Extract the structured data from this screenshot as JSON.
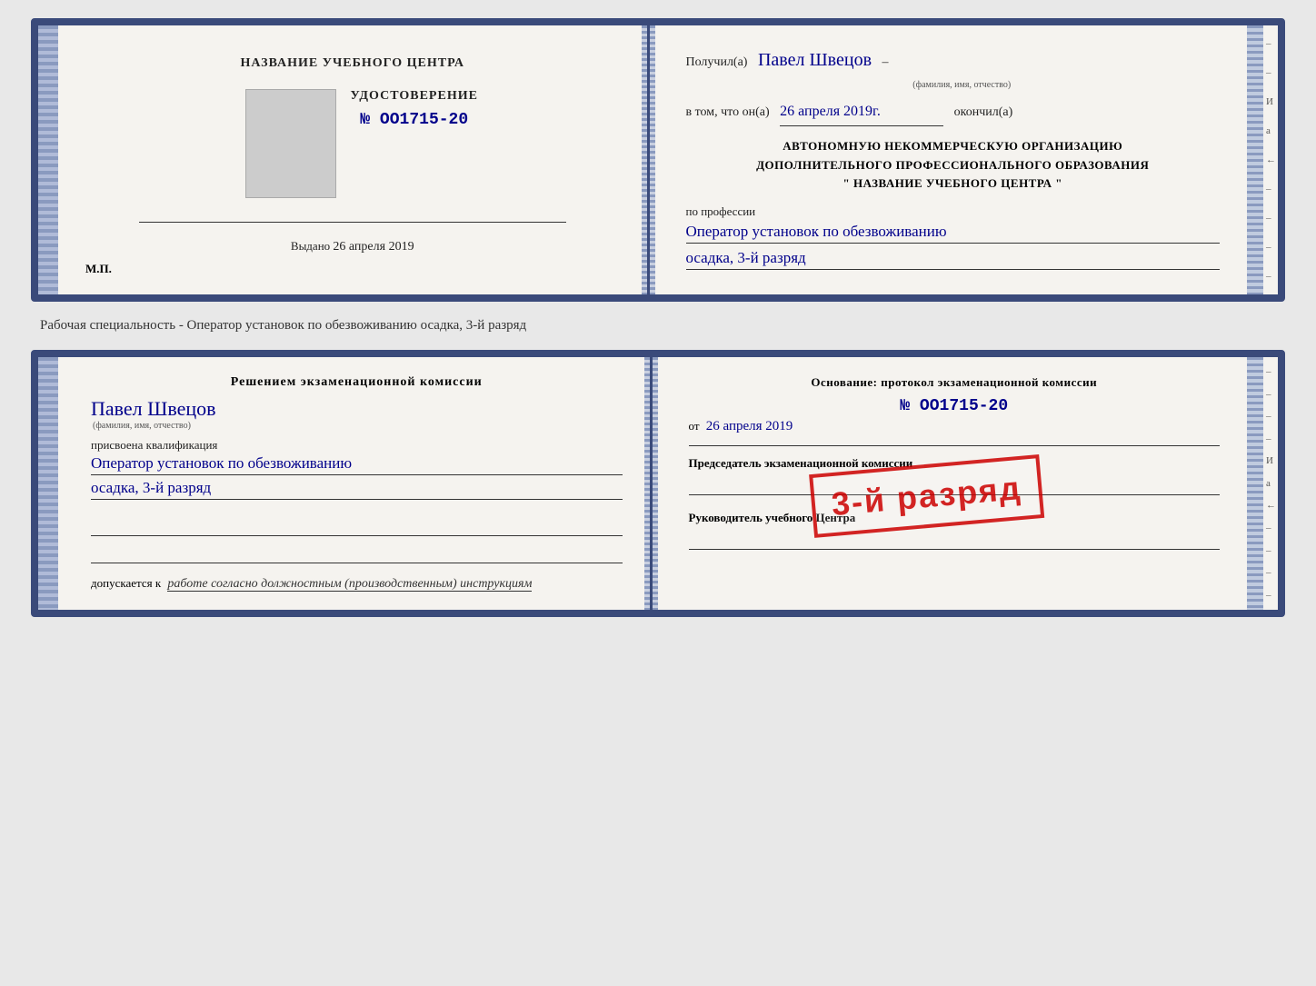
{
  "top_card": {
    "left": {
      "title": "НАЗВАНИЕ УЧЕБНОГО ЦЕНТРА",
      "cert_label": "УДОСТОВЕРЕНИЕ",
      "cert_number": "№ OO1715-20",
      "issued_prefix": "Выдано",
      "issued_date": "26 апреля 2019",
      "mp_label": "М.П."
    },
    "right": {
      "received_prefix": "Получил(а)",
      "recipient_name": "Павел Швецов",
      "name_sublabel": "(фамилия, имя, отчество)",
      "confirmed_prefix": "в том, что он(а)",
      "confirmed_date": "26 апреля 2019г.",
      "confirmed_suffix": "окончил(а)",
      "org_line1": "АВТОНОМНУЮ НЕКОММЕРЧЕСКУЮ ОРГАНИЗАЦИЮ",
      "org_line2": "ДОПОЛНИТЕЛЬНОГО ПРОФЕССИОНАЛЬНОГО ОБРАЗОВАНИЯ",
      "org_line3": "\"    НАЗВАНИЕ УЧЕБНОГО ЦЕНТРА    \"",
      "profession_prefix": "по профессии",
      "profession_value": "Оператор установок по обезвоживанию",
      "profession_line2": "осадка, 3-й разряд"
    }
  },
  "caption": "Рабочая специальность - Оператор установок по обезвоживанию осадка, 3-й разряд",
  "bottom_card": {
    "left": {
      "decision_title": "Решением экзаменационной комиссии",
      "person_name": "Павел Швецов",
      "name_sublabel": "(фамилия, имя, отчество)",
      "qualification_prefix": "присвоена квалификация",
      "qualification_value": "Оператор установок по обезвоживанию",
      "qualification_line2": "осадка, 3-й разряд",
      "allowed_prefix": "допускается к",
      "allowed_value": "работе согласно должностным (производственным) инструкциям"
    },
    "right": {
      "basis_title": "Основание: протокол экзаменационной комиссии",
      "basis_number": "№ OO1715-20",
      "from_prefix": "от",
      "from_date": "26 апреля 2019",
      "chairman_label": "Председатель экзаменационной комиссии",
      "director_label": "Руководитель учебного Центра"
    },
    "stamp": {
      "text": "3-й разряд"
    }
  }
}
